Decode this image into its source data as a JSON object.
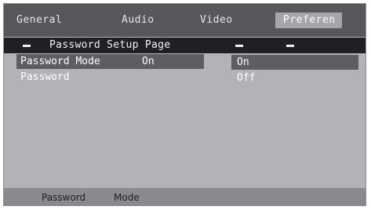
{
  "tabs": [
    {
      "label": "General"
    },
    {
      "label": "Audio"
    },
    {
      "label": "Video"
    },
    {
      "label": "Preferen"
    }
  ],
  "setup_bar": {
    "title": "Password Setup Page"
  },
  "menu": {
    "items": [
      {
        "label": "Password Mode",
        "value": "On"
      },
      {
        "label": "Password"
      }
    ]
  },
  "options": [
    {
      "label": "On"
    },
    {
      "label": "Off"
    }
  ],
  "status_bar": {
    "left": "Password",
    "right": "Mode"
  },
  "colors": {
    "panel": "#b3b3b7",
    "tab_bar": "#58585c",
    "title_bar": "#202024",
    "highlight": "#5e5e62"
  }
}
